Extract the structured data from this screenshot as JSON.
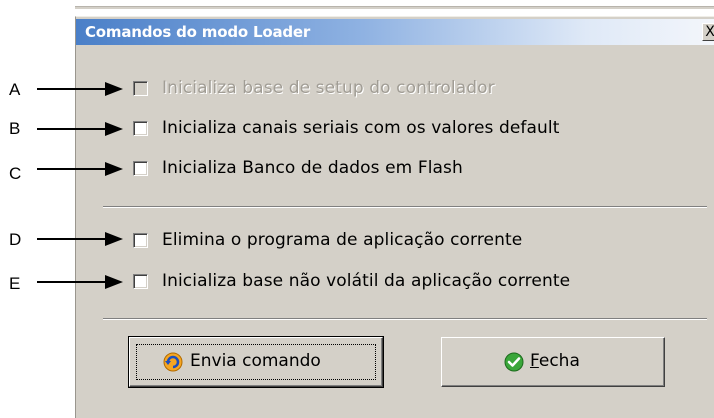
{
  "window": {
    "title": "Comandos do modo Loader",
    "close_glyph": "X"
  },
  "annotations": [
    "A",
    "B",
    "C",
    "D",
    "E"
  ],
  "options": [
    {
      "label": "Inicializa base de setup do controlador",
      "checked": false,
      "enabled": false
    },
    {
      "label": "Inicializa canais seriais com os valores default",
      "checked": false,
      "enabled": true
    },
    {
      "label": "Inicializa Banco de dados em Flash",
      "checked": false,
      "enabled": true
    },
    {
      "label": "Elimina o programa de aplicação corrente",
      "checked": false,
      "enabled": true
    },
    {
      "label": "Inicializa base não volátil da aplicação corrente",
      "checked": false,
      "enabled": true
    }
  ],
  "buttons": {
    "send": {
      "label": "Envia comando",
      "icon": "refresh-icon"
    },
    "close": {
      "label_accel": "F",
      "label_rest": "echa",
      "icon": "checkmark-icon"
    }
  },
  "colors": {
    "face": "#d4d0c8",
    "title_gradient_start": "#4a7fc8",
    "disabled_text": "#a19d95",
    "send_icon": "#f5a623",
    "close_icon": "#3aa63a"
  }
}
